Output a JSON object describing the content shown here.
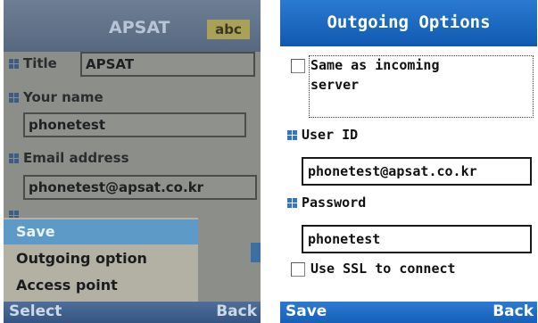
{
  "left_screen": {
    "title": "APSAT",
    "input_mode": "abc",
    "fields": {
      "title_label": "Title",
      "title_value": "APSAT",
      "your_name_label": "Your name",
      "your_name_value": "phonetest",
      "email_label": "Email address",
      "email_value": "phonetest@apsat.co.kr"
    },
    "menu": {
      "items": [
        {
          "label": "Save",
          "selected": true
        },
        {
          "label": "Outgoing option",
          "selected": false
        },
        {
          "label": "Access point",
          "selected": false
        }
      ]
    },
    "softkeys": {
      "left": "Select",
      "right": "Back"
    }
  },
  "right_screen": {
    "title": "Outgoing Options",
    "same_as_incoming_label": "Same as incoming server",
    "same_as_incoming_line1": "Same as incoming",
    "same_as_incoming_line2": "server",
    "user_id_label": "User ID",
    "user_id_value": "phonetest@apsat.co.kr",
    "password_label": "Password",
    "password_value": "phonetest",
    "use_ssl_label": "Use SSL to connect",
    "softkeys": {
      "left": "Save",
      "right": "Back"
    }
  },
  "colors": {
    "left_title_bg": "#56687f",
    "menu_selected_bg": "#5e9ac7",
    "right_title_bg": "#1159b0",
    "bullet": "#3474c4"
  }
}
